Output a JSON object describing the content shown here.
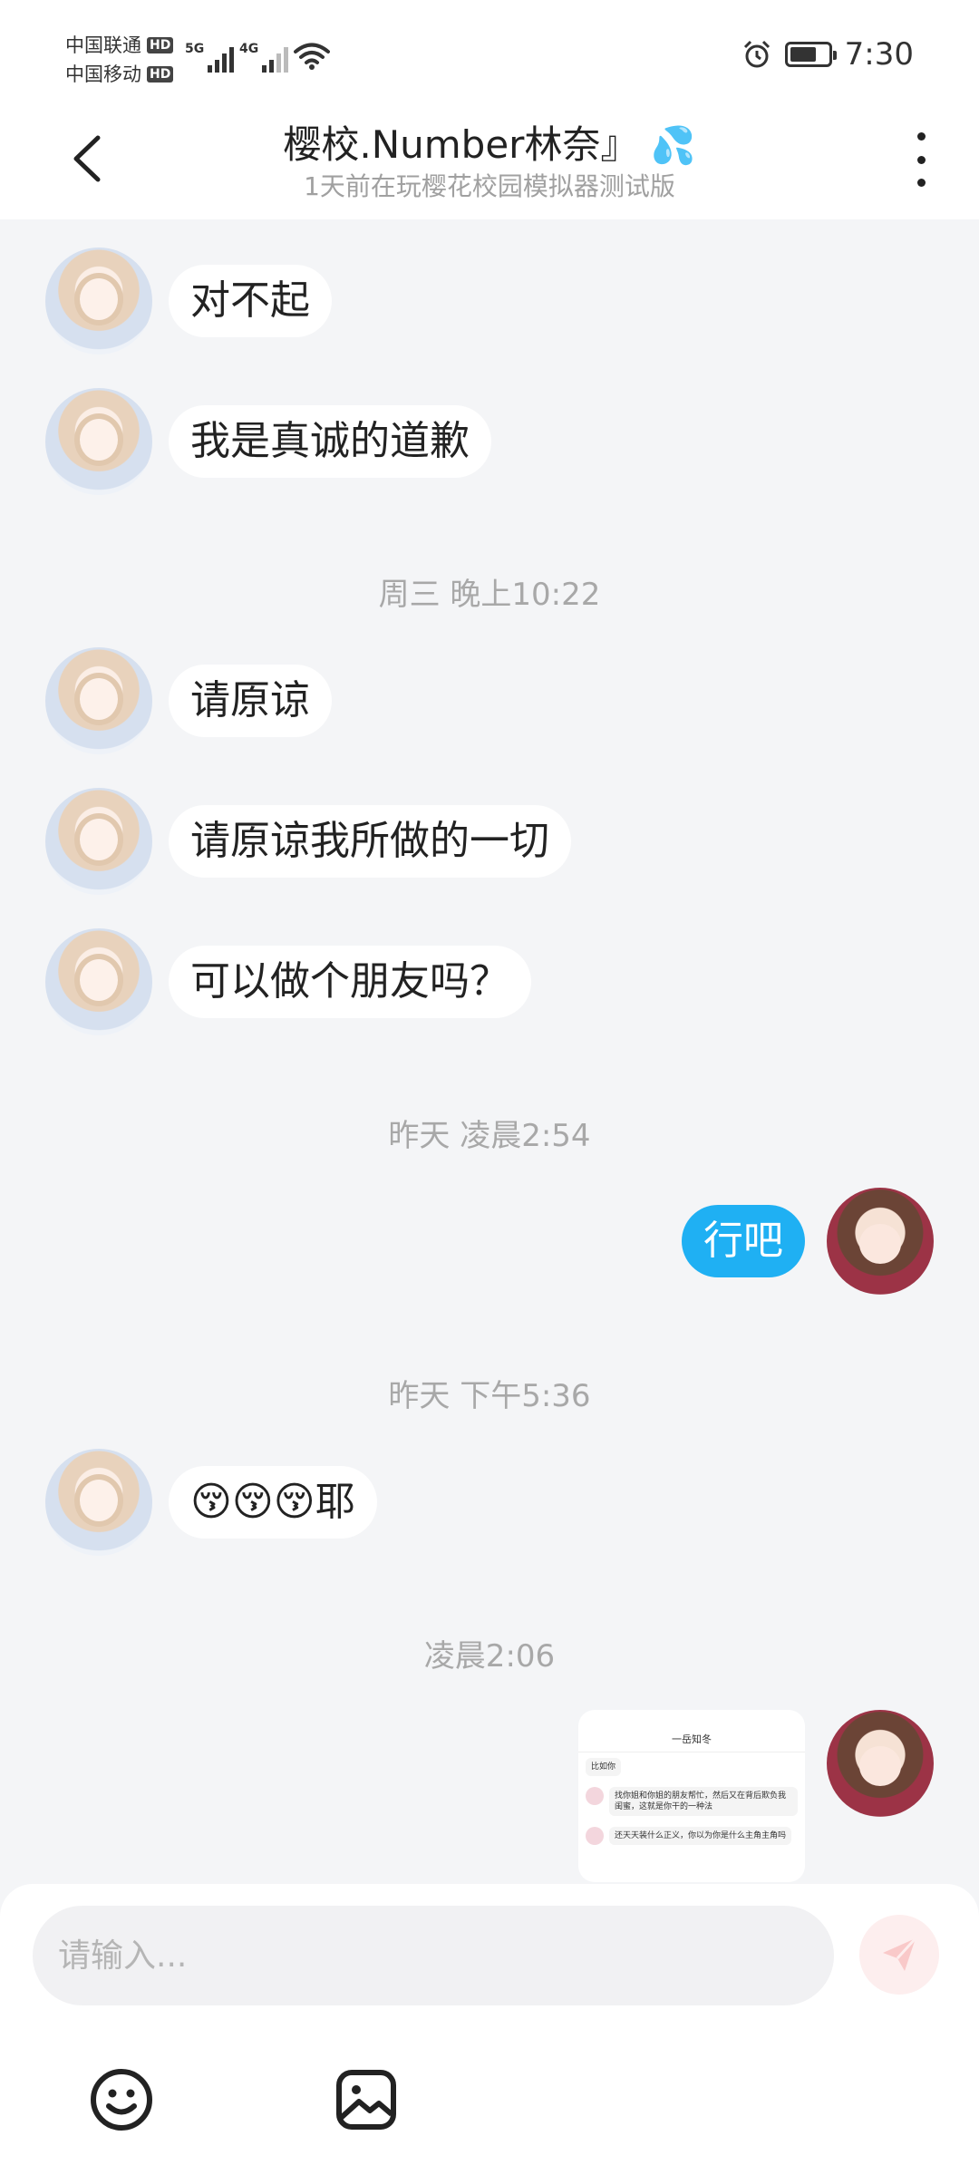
{
  "status_bar": {
    "carrier1": "中国联通",
    "carrier2": "中国移动",
    "hd": "HD",
    "sig1_label": "5G",
    "sig2_label": "4G",
    "time": "7:30",
    "battery_level": 0.7
  },
  "header": {
    "title": "樱校.Number林奈』",
    "title_emoji": "💦",
    "subtitle": "1天前在玩樱花校园模拟器测试版"
  },
  "messages": [
    {
      "text": "对不起"
    },
    {
      "text": "我是真诚的道歉"
    },
    {
      "time": "周三 晚上10:22"
    },
    {
      "text": "请原谅"
    },
    {
      "text": "请原谅我所做的一切"
    },
    {
      "text": "可以做个朋友吗？"
    },
    {
      "time": "昨天 凌晨2:54"
    },
    {
      "text": "行吧"
    },
    {
      "time": "昨天 下午5:36"
    },
    {
      "text": "😚😚😚耶"
    },
    {
      "time": "凌晨2:06"
    }
  ],
  "shared_screenshot": {
    "header": "一岳知冬",
    "lines": [
      "比如你",
      "找你姐和你姐的朋友帮忙，然后又在背后欺负我闺蜜，这就是你干的一种法",
      "还天天装什么正义，你以为你是什么主角主角吗"
    ]
  },
  "composer": {
    "placeholder": "请输入..."
  }
}
